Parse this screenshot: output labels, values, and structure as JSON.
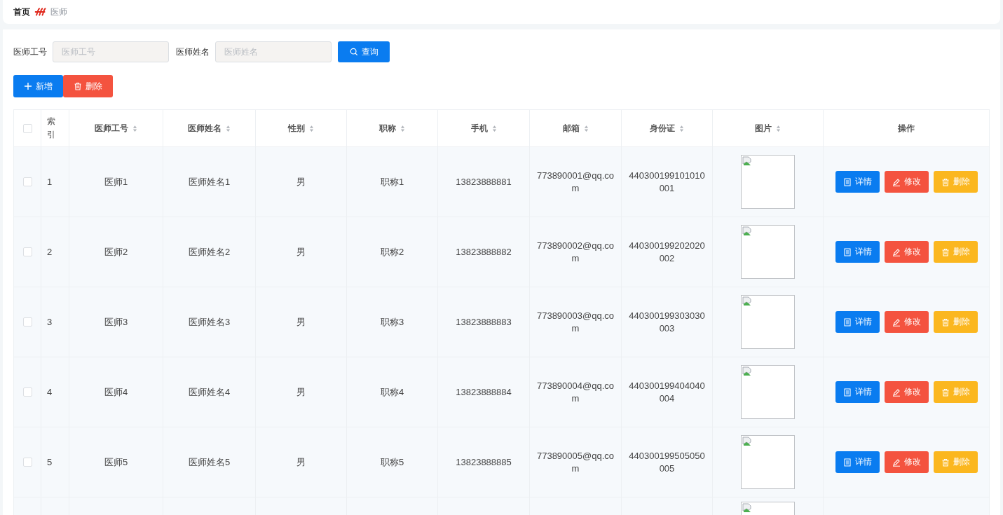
{
  "breadcrumb": [
    {
      "label": "首页",
      "current": false
    },
    {
      "label": "医师",
      "current": true
    }
  ],
  "search": {
    "fields": [
      {
        "label": "医师工号",
        "placeholder": "医师工号"
      },
      {
        "label": "医师姓名",
        "placeholder": "医师姓名"
      }
    ],
    "button": "查询"
  },
  "actions": [
    {
      "kind": "add",
      "label": "新增"
    },
    {
      "kind": "delete",
      "label": "删除"
    }
  ],
  "table": {
    "header_checked": false,
    "columns": [
      {
        "label": "索引",
        "sortable": false
      },
      {
        "label": "医师工号",
        "sortable": true
      },
      {
        "label": "医师姓名",
        "sortable": true
      },
      {
        "label": "性别",
        "sortable": true
      },
      {
        "label": "职称",
        "sortable": true
      },
      {
        "label": "手机",
        "sortable": true
      },
      {
        "label": "邮箱",
        "sortable": true
      },
      {
        "label": "身份证",
        "sortable": true
      },
      {
        "label": "图片",
        "sortable": true
      },
      {
        "label": "操作",
        "sortable": false
      }
    ],
    "rows": [
      {
        "checked": false,
        "cells": [
          "1",
          "医师1",
          "医师姓名1",
          "男",
          "职称1",
          "13823888881",
          "773890001@qq.com",
          "440300199101010001"
        ],
        "actions": [
          {
            "kind": "detail",
            "label": "详情"
          },
          {
            "kind": "edit",
            "label": "修改"
          },
          {
            "kind": "delete",
            "label": "删除"
          }
        ]
      },
      {
        "checked": false,
        "cells": [
          "2",
          "医师2",
          "医师姓名2",
          "男",
          "职称2",
          "13823888882",
          "773890002@qq.com",
          "440300199202020002"
        ],
        "actions": [
          {
            "kind": "detail",
            "label": "详情"
          },
          {
            "kind": "edit",
            "label": "修改"
          },
          {
            "kind": "delete",
            "label": "删除"
          }
        ]
      },
      {
        "checked": false,
        "cells": [
          "3",
          "医师3",
          "医师姓名3",
          "男",
          "职称3",
          "13823888883",
          "773890003@qq.com",
          "440300199303030003"
        ],
        "actions": [
          {
            "kind": "detail",
            "label": "详情"
          },
          {
            "kind": "edit",
            "label": "修改"
          },
          {
            "kind": "delete",
            "label": "删除"
          }
        ]
      },
      {
        "checked": false,
        "cells": [
          "4",
          "医师4",
          "医师姓名4",
          "男",
          "职称4",
          "13823888884",
          "773890004@qq.com",
          "440300199404040004"
        ],
        "actions": [
          {
            "kind": "detail",
            "label": "详情"
          },
          {
            "kind": "edit",
            "label": "修改"
          },
          {
            "kind": "delete",
            "label": "删除"
          }
        ]
      },
      {
        "checked": false,
        "cells": [
          "5",
          "医师5",
          "医师姓名5",
          "男",
          "职称5",
          "13823888885",
          "773890005@qq.com",
          "440300199505050005"
        ],
        "actions": [
          {
            "kind": "detail",
            "label": "详情"
          },
          {
            "kind": "edit",
            "label": "修改"
          },
          {
            "kind": "delete",
            "label": "删除"
          }
        ]
      },
      {
        "cells": [],
        "actions": []
      }
    ]
  }
}
